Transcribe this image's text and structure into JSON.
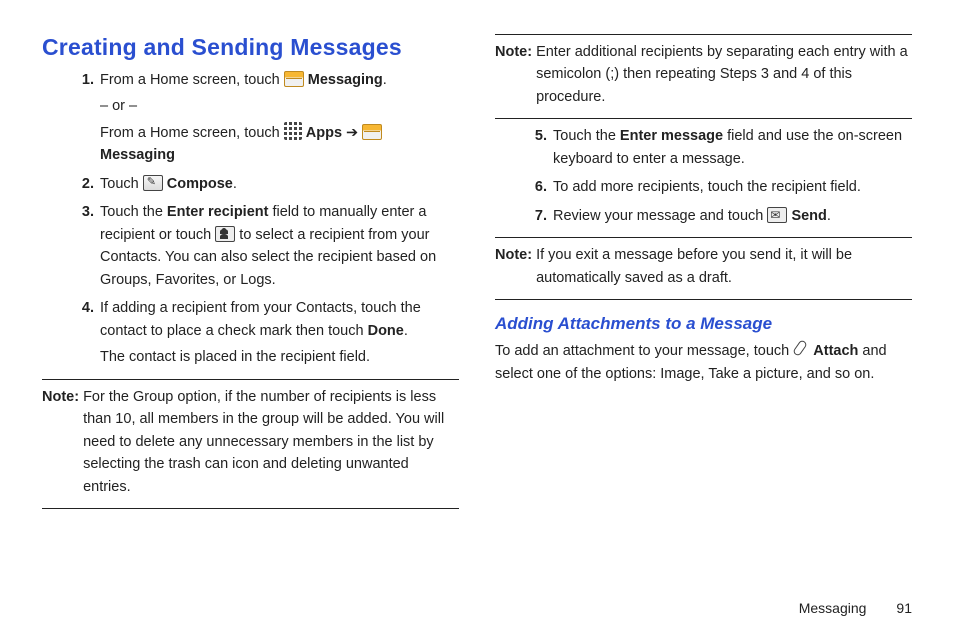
{
  "heading_main": "Creating and Sending Messages",
  "step1_a_pre": "From a Home screen, touch ",
  "step1_a_bold": "Messaging",
  "step1_a_post": ".",
  "step1_or": "– or –",
  "step1_b_pre": "From a Home screen, touch ",
  "step1_b_apps": "Apps",
  "step1_b_arrow": " ➔ ",
  "step1_b_msg": "Messaging",
  "step2_pre": "Touch ",
  "step2_bold": "Compose",
  "step2_post": ".",
  "step3_pre": "Touch the ",
  "step3_b1": "Enter recipient",
  "step3_mid": " field to manually enter a recipient or touch ",
  "step3_post": " to select a recipient from your Contacts. You can also select the recipient based on Groups, Favorites, or Logs.",
  "step4_pre": "If adding a recipient from your Contacts, touch the contact to place a check mark then touch ",
  "step4_bold": "Done",
  "step4_post": ".",
  "step4_extra": "The contact is placed in the recipient field.",
  "note_label": "Note:",
  "note1_body": "For the Group option, if the number of recipients is less than 10, all members in the group will be added. You will need to delete any unnecessary members in the list by selecting the trash can icon and deleting unwanted entries.",
  "note2_body": "Enter additional recipients by separating each entry with a semicolon (;) then repeating Steps 3 and 4 of this procedure.",
  "step5_pre": "Touch the ",
  "step5_bold": "Enter message",
  "step5_post": " field and use the on-screen keyboard to enter a message.",
  "step6": "To add more recipients, touch the recipient field.",
  "step7_pre": "Review your message and touch ",
  "step7_bold": "Send",
  "step7_post": ".",
  "note3_body": "If you exit a message before you send it, it will be automatically saved as a draft.",
  "heading_sub": "Adding Attachments to a Message",
  "attach_pre": "To add an attachment to your message, touch ",
  "attach_bold": "Attach",
  "attach_post": " and select one of the options: Image, Take a picture, and so on.",
  "footer_chapter": "Messaging",
  "footer_page": "91"
}
